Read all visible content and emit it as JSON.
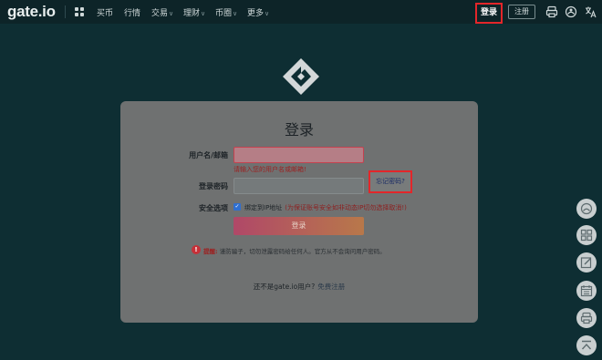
{
  "header": {
    "logo": "gate.io",
    "nav": [
      {
        "label": "买币",
        "has_caret": false
      },
      {
        "label": "行情",
        "has_caret": false
      },
      {
        "label": "交易",
        "has_caret": true
      },
      {
        "label": "理财",
        "has_caret": true
      },
      {
        "label": "币圈",
        "has_caret": true
      },
      {
        "label": "更多",
        "has_caret": true
      }
    ],
    "login_label": "登录",
    "register_label": "注册",
    "icons": [
      "app-download-icon",
      "support-icon",
      "language-icon"
    ]
  },
  "login_form": {
    "title": "登录",
    "username_label": "用户名/邮箱",
    "username_value": "",
    "username_error": "请输入您的用户名或邮箱!",
    "password_label": "登录密码",
    "password_value": "",
    "forgot_password": "忘记密码?",
    "security_label": "安全选项",
    "bind_ip_label": "绑定到IP地址",
    "bind_ip_checked": true,
    "bind_ip_note": "(为保证账号安全如非动态IP切勿选择取消!)",
    "submit_label": "登录",
    "warning_head": "提醒:",
    "warning_text": "谨防骗子，切勿泄露密码给任何人。官方从不会询问用户密码。",
    "not_user_text": "还不是gate.io用户?",
    "register_link": "免费注册"
  },
  "side_toolbar": [
    "customer-service-icon",
    "apps-grid-icon",
    "edit-icon",
    "calendar-icon",
    "chat-icon",
    "back-to-top-icon"
  ],
  "colors": {
    "page_bg": "#0e2e33",
    "topbar_bg": "#0d2428",
    "card_bg": "#6f7171",
    "highlight": "#e3262a",
    "error_text": "#9d1f1f",
    "button_gradient_start": "#b04868",
    "button_gradient_end": "#b8784a"
  }
}
